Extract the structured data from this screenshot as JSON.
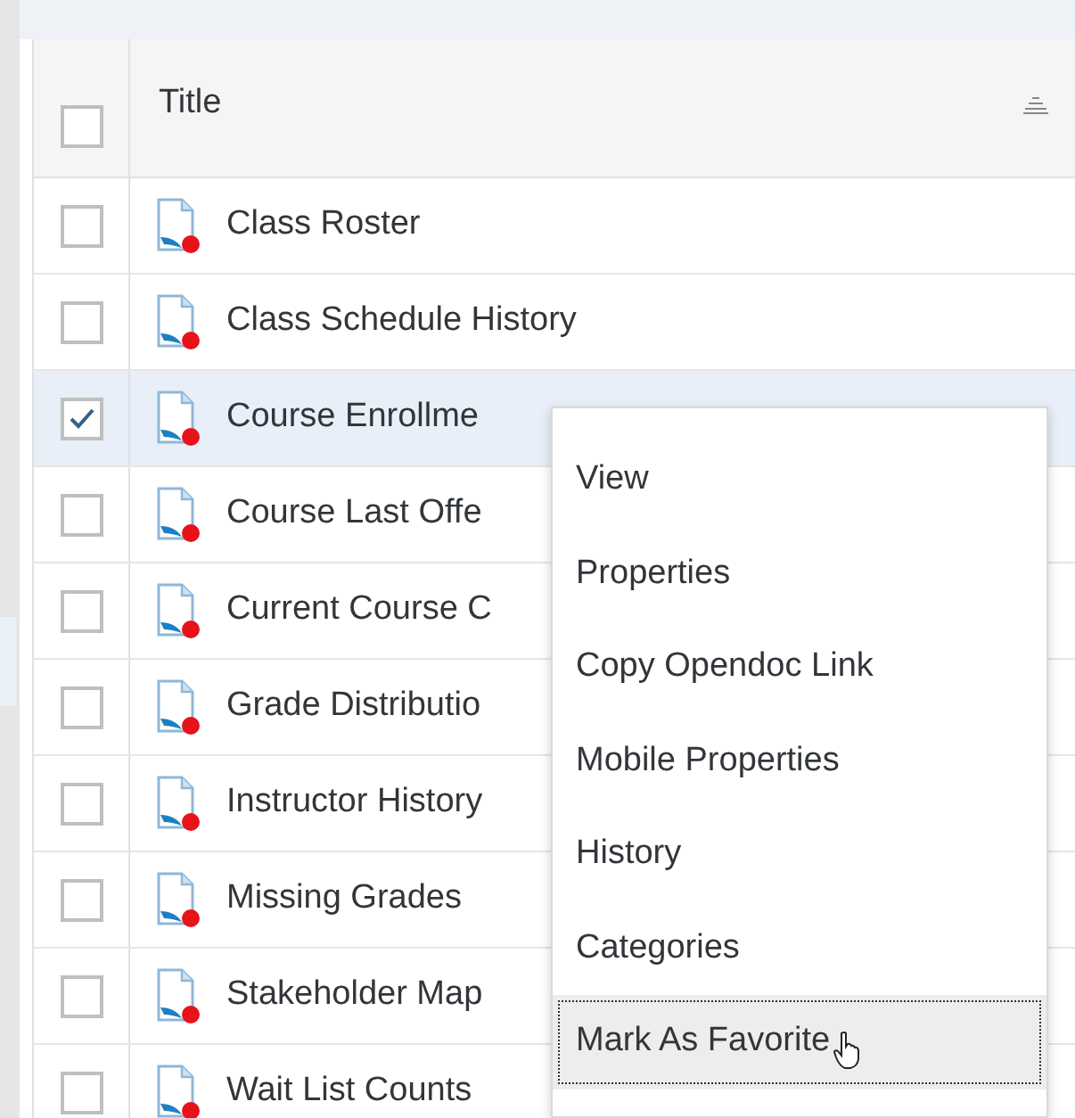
{
  "table": {
    "columns": [
      {
        "label": "Title"
      }
    ],
    "header_checkbox": {
      "checked": false
    },
    "rows": [
      {
        "title": "Class Roster",
        "selected": false
      },
      {
        "title": "Class Schedule History",
        "selected": false
      },
      {
        "title": "Course Enrollme",
        "selected": true
      },
      {
        "title": "Course Last Offe",
        "selected": false
      },
      {
        "title": "Current Course C",
        "selected": false
      },
      {
        "title": "Grade Distributio",
        "selected": false
      },
      {
        "title": "Instructor History",
        "selected": false
      },
      {
        "title": "Missing Grades",
        "selected": false
      },
      {
        "title": "Stakeholder Map",
        "selected": false
      },
      {
        "title": "Wait List Counts",
        "selected": false
      }
    ]
  },
  "context_menu": {
    "items": [
      {
        "label": "View",
        "hovered": false
      },
      {
        "label": "Properties",
        "hovered": false
      },
      {
        "label": "Copy Opendoc Link",
        "hovered": false
      },
      {
        "label": "Mobile Properties",
        "hovered": false
      },
      {
        "label": "History",
        "hovered": false
      },
      {
        "label": "Categories",
        "hovered": false
      },
      {
        "label": "Mark As Favorite",
        "hovered": true
      }
    ]
  }
}
